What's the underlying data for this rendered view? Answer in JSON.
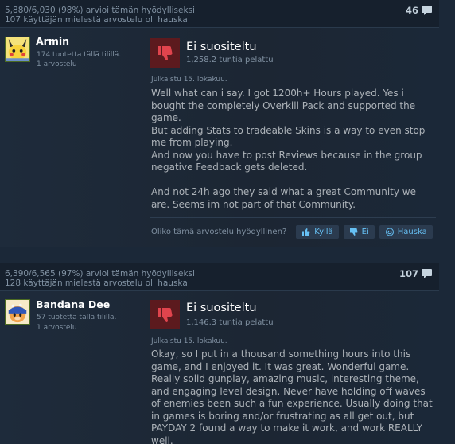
{
  "reviews": [
    {
      "helpful_stats": "5,880/6,030 (98%) arvioi tämän hyödylliseksi",
      "funny_stats": "107 käyttäjän mielestä arvostelu oli hauska",
      "comment_count": "46",
      "author": "Armin",
      "products_owned": "174 tuotetta tällä tilillä.",
      "review_count": "1 arvostelu",
      "verdict": "Ei suositeltu",
      "hours": "1,258.2 tuntia pelattu",
      "posted": "Julkaistu 15. lokakuu.",
      "text": "Well what can i say. I got 1200h+ Hours played. Yes i bought the completely Overkill Pack and supported the game.\nBut adding Stats to tradeable Skins is a way to even stop me from playing.\nAnd now you have to post Reviews because in the group negative Feedback gets deleted.\n\nAnd not 24h ago they said what a great Community we are. Seems im not part of that Community.",
      "helpful_question": "Oliko tämä arvostelu hyödyllinen?",
      "yes_label": "Kyllä",
      "no_label": "Ei",
      "funny_label": "Hauska"
    },
    {
      "helpful_stats": "6,390/6,565 (97%) arvioi tämän hyödylliseksi",
      "funny_stats": "128 käyttäjän mielestä arvostelu oli hauska",
      "comment_count": "107",
      "author": "Bandana Dee",
      "products_owned": "57 tuotetta tällä tilillä.",
      "review_count": "1 arvostelu",
      "verdict": "Ei suositeltu",
      "hours": "1,146.3 tuntia pelattu",
      "posted": "Julkaistu 15. lokakuu.",
      "text": "Okay, so I put in a thousand something hours into this game, and I enjoyed it. It was great. Wonderful game. Really solid gunplay, amazing music, interesting theme, and engaging level design. Never have holding off waves of enemies been such a fun experience. Usually doing that in games is boring and/or frustrating as all get out, but PAYDAY 2 found a way to make it work, and work REALLY well."
    }
  ],
  "colors": {
    "background": "#1b2838",
    "thumb_down_bg": "#5c1a1e",
    "thumb_down_icon": "#e0444d",
    "link_blue": "#66c0f4"
  },
  "icons": {
    "comment": "speech-bubble-icon",
    "verdict": "thumbs-down-icon",
    "yes": "thumbs-up-icon",
    "no": "thumbs-down-icon",
    "funny": "smiley-icon"
  }
}
